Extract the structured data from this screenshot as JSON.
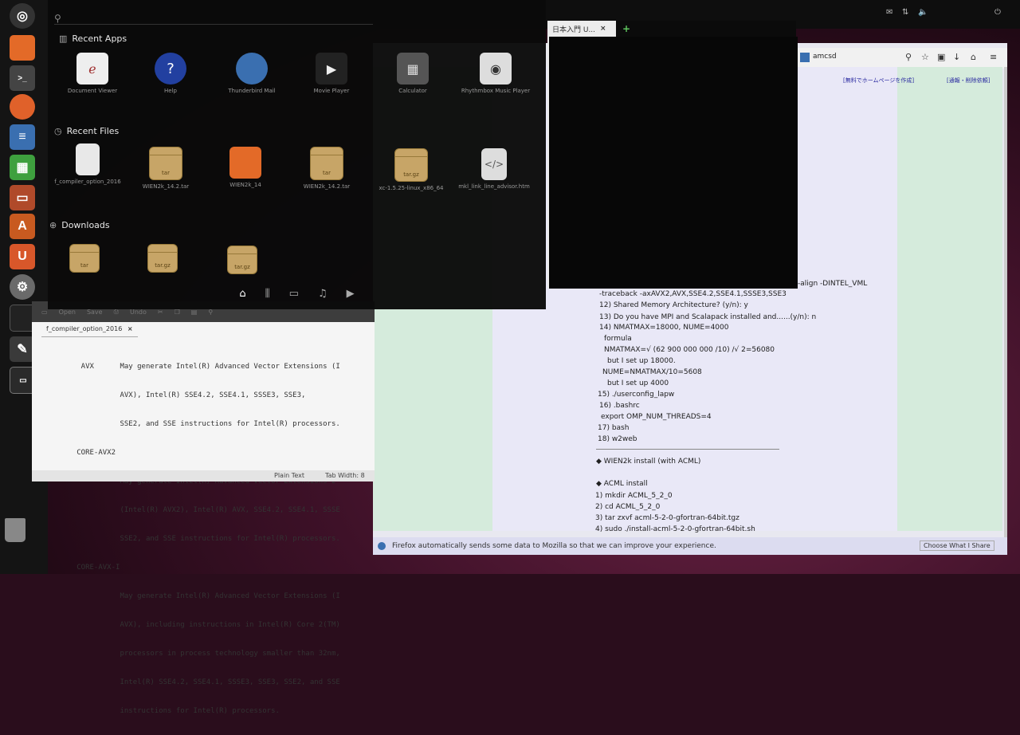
{
  "colors": {
    "launcher_bg": "#141414",
    "dash_bg": "#0a0a0a",
    "folder": "#c7a567",
    "terminal_bg": "#070707",
    "page_bg": "#e9e8f7",
    "page_green": "#d5ebdc"
  },
  "dash": {
    "recent_apps_title": "Recent Apps",
    "recent_files_title": "Recent Files",
    "downloads_title": "Downloads",
    "apps": [
      {
        "label": "Document Viewer",
        "icon": "document-viewer-icon"
      },
      {
        "label": "Help",
        "icon": "help-icon"
      },
      {
        "label": "Thunderbird Mail",
        "icon": "thunderbird-icon"
      },
      {
        "label": "Movie Player",
        "icon": "movie-player-icon"
      },
      {
        "label": "Calculator",
        "icon": "calculator-icon"
      },
      {
        "label": "Rhythmbox Music Player",
        "icon": "rhythmbox-icon"
      }
    ],
    "files": [
      {
        "label": "f_compiler_option_2016",
        "badge": ""
      },
      {
        "label": "WIEN2k_14.2.tar",
        "badge": "tar"
      },
      {
        "label": "WIEN2k_14",
        "badge": ""
      },
      {
        "label": "WIEN2k_14.2.tar",
        "badge": "tar"
      },
      {
        "label": "xc-1.5.25-linux_x86_64",
        "badge": "tar.gz"
      },
      {
        "label": "mkl_link_line_advisor.htm",
        "badge": ""
      }
    ],
    "downloads": [
      {
        "badge": "tar"
      },
      {
        "badge": "tar.gz"
      },
      {
        "badge": "tar.gz"
      }
    ]
  },
  "terminal": {
    "tab_label": "日本入門 U..."
  },
  "firefox": {
    "url": "amcsd",
    "link_left": "[無料でホームページを作成]",
    "link_right": "[通報・削除依頼]",
    "lines": [
      "-align -DINTEL_VML",
      "-traceback -axAVX2,AVX,SSE4.2,SSE4.1,SSSE3,SSE3",
      "12) Shared Memory Architecture? (y/n): y",
      "13) Do you have MPI and Scalapack installed and......(y/n): n",
      "14) NMATMAX=18000, NUME=4000",
      "formula",
      "NMATMAX=√ (62 900 000 000 /10) /√ 2=56080",
      "but I set up 18000.",
      "NUME=NMATMAX/10=5608",
      "but I set up 4000",
      "15) ./userconfig_lapw",
      "16) .bashrc",
      "export OMP_NUM_THREADS=4",
      "17) bash",
      "18) w2web",
      "◆ WIEN2k install (with ACML)",
      "◆ ACML install",
      "1) mkdir ACML_5_2_0",
      "2) cd ACML_5_2_0",
      "3) tar zxvf acml-5-2-0-gfortran-64bit.tgz",
      "4) sudo ./install-acml-5-2-0-gfortran-64bit.sh"
    ],
    "notice": "Firefox automatically sends some data to Mozilla so that we can improve your experience.",
    "notice_button": "Choose What I Share"
  },
  "gedit": {
    "open": "Open",
    "save": "Save",
    "undo": "Undo",
    "tab": "f_compiler_option_2016",
    "code": [
      "    AVX      May generate Intel(R) Advanced Vector Extensions (I",
      "             AVX), Intel(R) SSE4.2, SSE4.1, SSSE3, SSE3,",
      "             SSE2, and SSE instructions for Intel(R) processors.",
      "   CORE-AVX2",
      "             May generate Intel(R) Advanced Vector Extensions 2",
      "             (Intel(R) AVX2), Intel(R) AVX, SSE4.2, SSE4.1, SSSE",
      "             SSE2, and SSE instructions for Intel(R) processors.",
      "   CORE-AVX-I",
      "             May generate Intel(R) Advanced Vector Extensions (I",
      "             AVX), including instructions in Intel(R) Core 2(TM)",
      "             processors in process technology smaller than 32nm,",
      "             Intel(R) SSE4.2, SSE4.1, SSSE3, SSE3, SSE2, and SSE",
      "             instructions for Intel(R) processors."
    ],
    "status_lang": "Plain Text",
    "status_tab": "Tab Width: 8"
  },
  "launcher": [
    {
      "icon": "dash-icon"
    },
    {
      "icon": "files-icon"
    },
    {
      "icon": "terminal-icon"
    },
    {
      "icon": "firefox-icon"
    },
    {
      "icon": "writer-icon"
    },
    {
      "icon": "calc-icon"
    },
    {
      "icon": "impress-icon"
    },
    {
      "icon": "software-center-icon"
    },
    {
      "icon": "ubuntu-one-icon"
    },
    {
      "icon": "settings-icon"
    },
    {
      "icon": "system-monitor-icon"
    },
    {
      "icon": "text-editor-icon"
    },
    {
      "icon": "terminal2-icon"
    }
  ]
}
